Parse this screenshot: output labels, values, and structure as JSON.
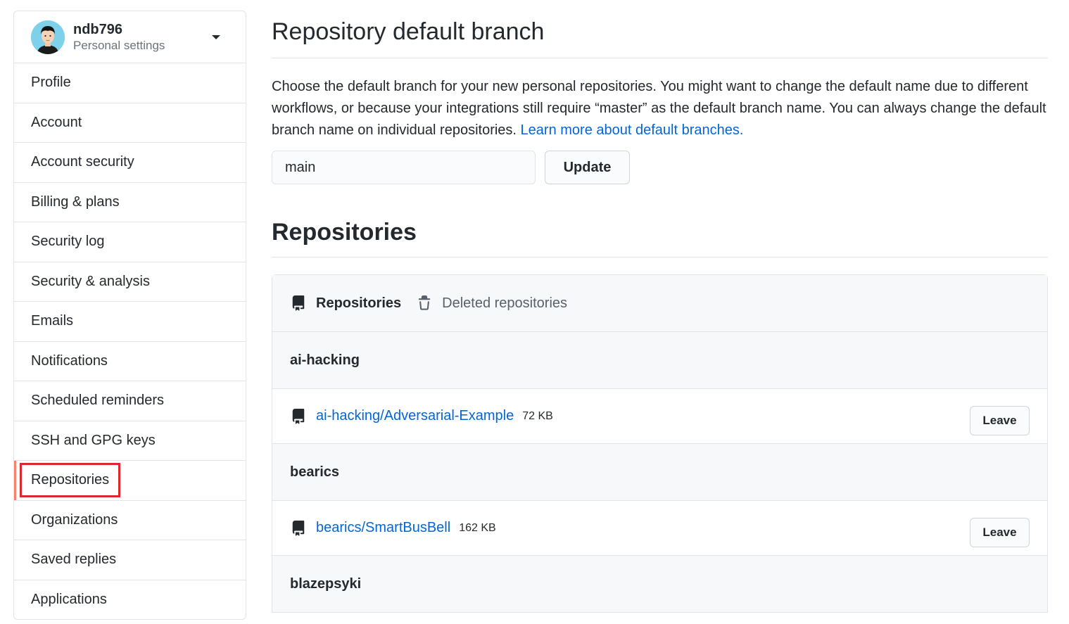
{
  "sidebar": {
    "username": "ndb796",
    "subtitle": "Personal settings",
    "items": [
      {
        "label": "Profile"
      },
      {
        "label": "Account"
      },
      {
        "label": "Account security"
      },
      {
        "label": "Billing & plans"
      },
      {
        "label": "Security log"
      },
      {
        "label": "Security & analysis"
      },
      {
        "label": "Emails"
      },
      {
        "label": "Notifications"
      },
      {
        "label": "Scheduled reminders"
      },
      {
        "label": "SSH and GPG keys"
      },
      {
        "label": "Repositories"
      },
      {
        "label": "Organizations"
      },
      {
        "label": "Saved replies"
      },
      {
        "label": "Applications"
      }
    ],
    "selected": "Repositories"
  },
  "default_branch": {
    "title": "Repository default branch",
    "description": "Choose the default branch for your new personal repositories. You might want to change the default name due to different workflows, or because your integrations still require “master” as the default branch name. You can always change the default branch name on individual repositories. ",
    "learn_more": "Learn more about default branches.",
    "branch_value": "main",
    "update_label": "Update"
  },
  "repositories": {
    "title": "Repositories",
    "tabs": [
      {
        "label": "Repositories",
        "icon": "repo-icon"
      },
      {
        "label": "Deleted repositories",
        "icon": "trash-icon"
      }
    ],
    "orgs": [
      {
        "name": "ai-hacking",
        "repos": [
          {
            "name": "ai-hacking/Adversarial-Example",
            "size": "72 KB",
            "action": "Leave"
          }
        ]
      },
      {
        "name": "bearics",
        "repos": [
          {
            "name": "bearics/SmartBusBell",
            "size": "162 KB",
            "action": "Leave"
          }
        ]
      },
      {
        "name": "blazepsyki",
        "repos": []
      }
    ]
  },
  "colors": {
    "link": "#0366d6",
    "selected_bar": "#f9826c",
    "highlight_box": "#e0262f"
  }
}
